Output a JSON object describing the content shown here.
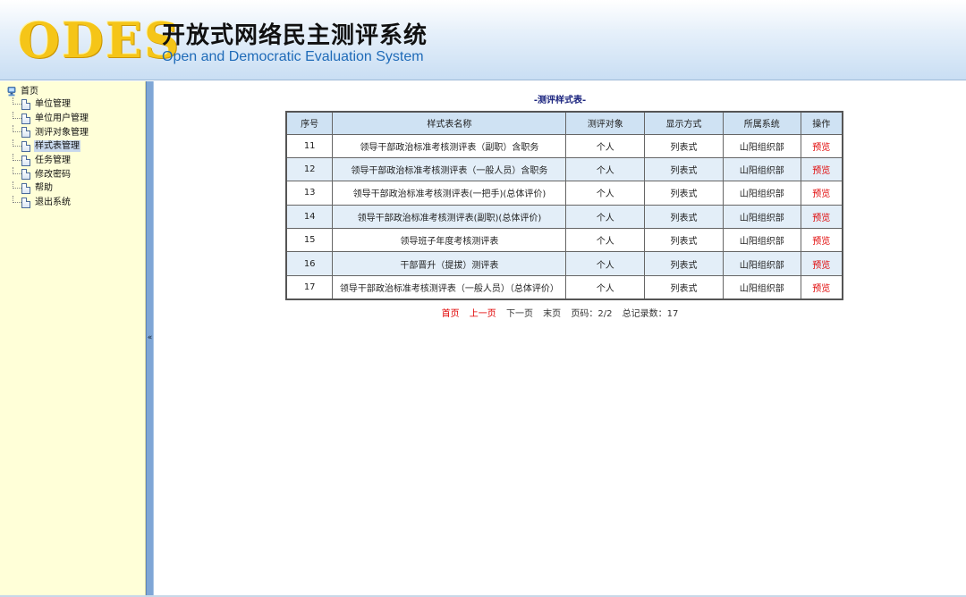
{
  "header": {
    "logo": "ODES",
    "title_cn": "开放式网络民主测评系统",
    "title_en": "Open and Democratic Evaluation System"
  },
  "sidebar": {
    "root": "首页",
    "items": [
      {
        "label": "单位管理"
      },
      {
        "label": "单位用户管理"
      },
      {
        "label": "测评对象管理"
      },
      {
        "label": "样式表管理",
        "selected": true
      },
      {
        "label": "任务管理"
      },
      {
        "label": "修改密码"
      },
      {
        "label": "帮助"
      },
      {
        "label": "退出系统"
      }
    ],
    "collapse_glyph": "«"
  },
  "main": {
    "title": "-测评样式表-",
    "columns": [
      "序号",
      "样式表名称",
      "测评对象",
      "显示方式",
      "所属系统",
      "操作"
    ],
    "rows": [
      {
        "id": "11",
        "name": "领导干部政治标准考核测评表（副职）含职务",
        "target": "个人",
        "display": "列表式",
        "system": "山阳组织部",
        "action": "预览"
      },
      {
        "id": "12",
        "name": "领导干部政治标准考核测评表（一般人员）含职务",
        "target": "个人",
        "display": "列表式",
        "system": "山阳组织部",
        "action": "预览"
      },
      {
        "id": "13",
        "name": "领导干部政治标准考核测评表(一把手)(总体评价)",
        "target": "个人",
        "display": "列表式",
        "system": "山阳组织部",
        "action": "预览"
      },
      {
        "id": "14",
        "name": "领导干部政治标准考核测评表(副职)(总体评价)",
        "target": "个人",
        "display": "列表式",
        "system": "山阳组织部",
        "action": "预览"
      },
      {
        "id": "15",
        "name": "领导班子年度考核测评表",
        "target": "个人",
        "display": "列表式",
        "system": "山阳组织部",
        "action": "预览"
      },
      {
        "id": "16",
        "name": "干部晋升（提拔）测评表",
        "target": "个人",
        "display": "列表式",
        "system": "山阳组织部",
        "action": "预览"
      },
      {
        "id": "17",
        "name": "领导干部政治标准考核测评表（一般人员）（总体评价）",
        "target": "个人",
        "display": "列表式",
        "system": "山阳组织部",
        "action": "预览"
      }
    ],
    "pager": {
      "first": "首页",
      "prev": "上一页",
      "next": "下一页",
      "last": "末页",
      "page_info": "页码：2/2",
      "total": "总记录数：17"
    }
  },
  "colors": {
    "accent_red": "#e00000",
    "header_blue": "#cfe2f3",
    "sidebar_bg": "#ffffd8",
    "logo_yellow": "#f5c518",
    "title_en_blue": "#1f6bb8"
  }
}
